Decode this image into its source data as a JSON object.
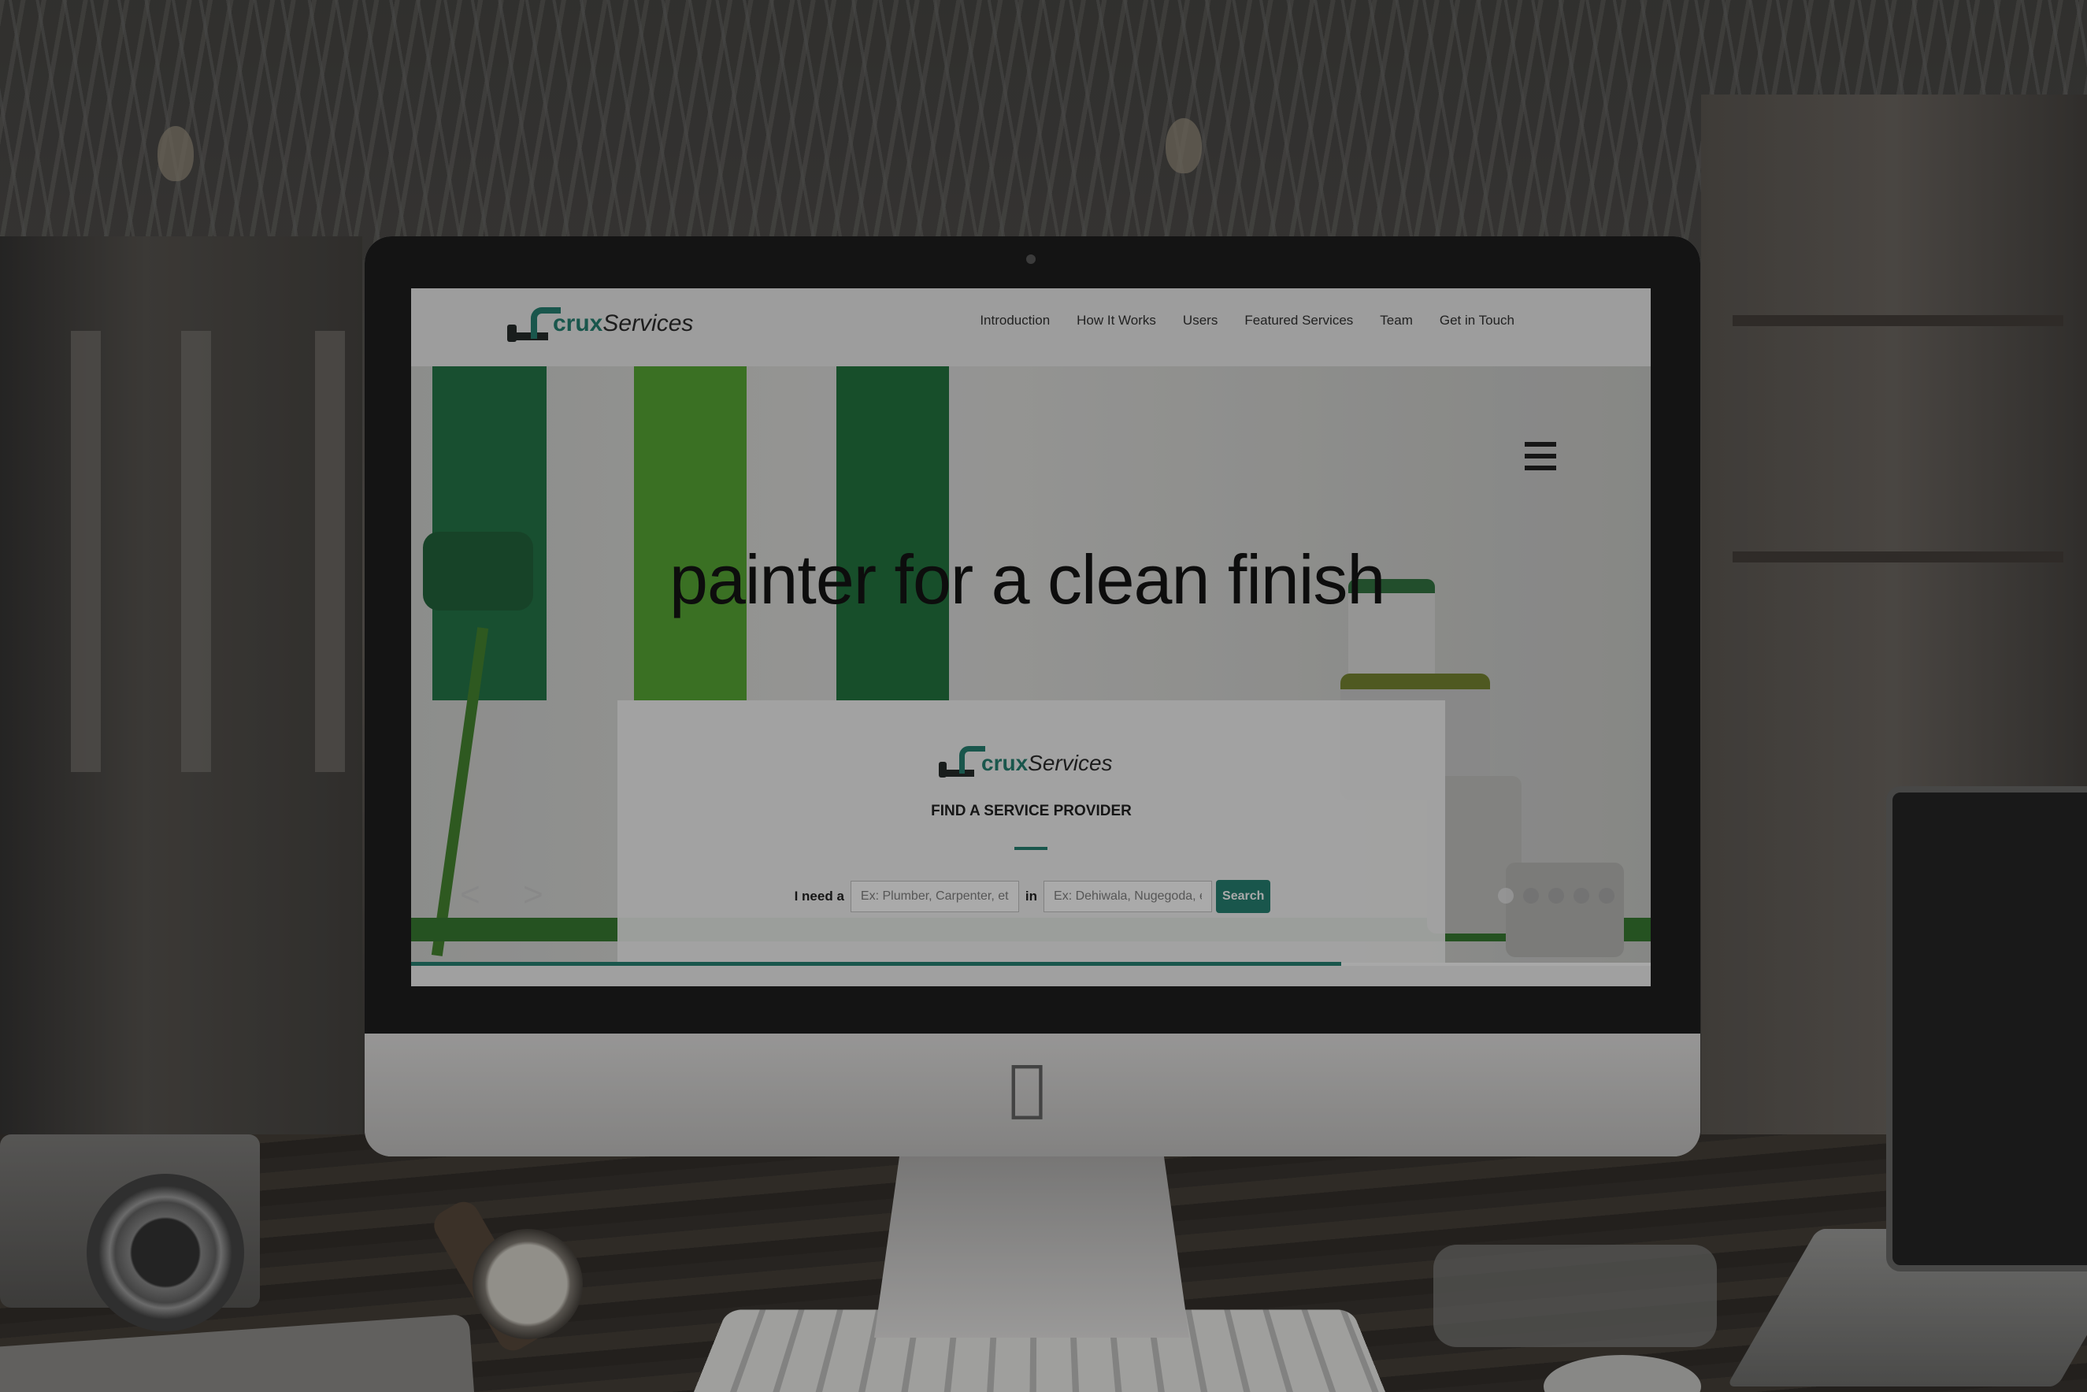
{
  "site": {
    "logo_crux": "crux",
    "logo_services": "Services",
    "nav": [
      "Introduction",
      "How It Works",
      "Users",
      "Featured Services",
      "Team",
      "Get in Touch"
    ]
  },
  "hero": {
    "headline": "painter for a clean finish",
    "prev_arrow": "<",
    "next_arrow": ">",
    "slides_count": 5,
    "active_slide": 1
  },
  "search_card": {
    "logo_crux": "crux",
    "logo_services": "Services",
    "heading": "FIND A SERVICE PROVIDER",
    "need_label": "I need a",
    "service_placeholder": "Ex: Plumber, Carpenter, et",
    "in_label": "in",
    "location_placeholder": "Ex: Dehiwala, Nugegoda, e",
    "search_button": "Search"
  },
  "slider_progress": 0.75,
  "colors": {
    "brand": "#1f7566",
    "stripe_dark": "#1d6b3f",
    "stripe_light": "#4d9b2d"
  },
  "icons": {
    "menu": "hamburger-icon",
    "device_logo": "apple-logo-icon"
  }
}
